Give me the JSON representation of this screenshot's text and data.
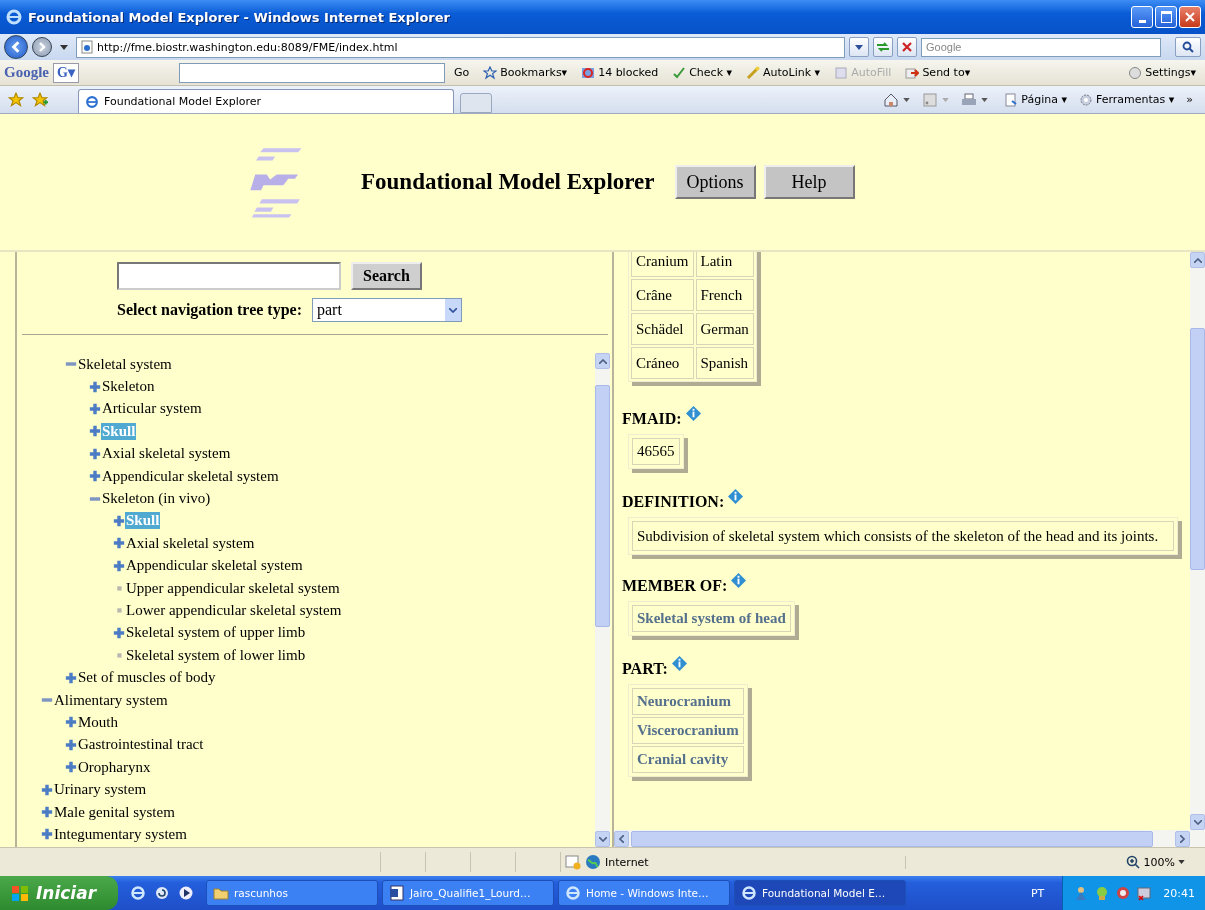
{
  "window": {
    "title": "Foundational Model Explorer - Windows Internet Explorer"
  },
  "address_bar": {
    "url": "http://fme.biostr.washington.edu:8089/FME/index.html",
    "search_placeholder": "Google"
  },
  "google_toolbar": {
    "logo": "Google",
    "menu": "G▾",
    "items": [
      {
        "kind": "go",
        "label": "Go",
        "disabled": false
      },
      {
        "kind": "bookmarks",
        "label": "Bookmarks▾",
        "disabled": false
      },
      {
        "kind": "blocked",
        "label": "14 blocked",
        "disabled": false
      },
      {
        "kind": "check",
        "label": "Check ▾",
        "disabled": false
      },
      {
        "kind": "autolink",
        "label": "AutoLink ▾",
        "disabled": false
      },
      {
        "kind": "autofill",
        "label": "AutoFill",
        "disabled": true
      },
      {
        "kind": "sendto",
        "label": "Send to▾",
        "disabled": false
      }
    ],
    "settings": "Settings▾"
  },
  "tabs": [
    {
      "label": "Foundational Model Explorer",
      "selected": true
    }
  ],
  "command_bar": [
    "Página ▾",
    "Ferramentas ▾",
    "»"
  ],
  "header": {
    "title": "Foundational Model Explorer",
    "buttons": [
      "Options",
      "Help"
    ]
  },
  "search": {
    "button": "Search",
    "tree_type_label": "Select navigation tree type:",
    "tree_type": "part"
  },
  "tree": {
    "continued_children": [
      {
        "label": "Skeletal system",
        "kind": "node",
        "expanded": true,
        "selected": false,
        "children": [
          {
            "label": "Skeleton",
            "kind": "node",
            "expanded": false,
            "selected": false
          },
          {
            "label": "Articular system",
            "kind": "node",
            "expanded": false,
            "selected": false
          },
          {
            "label": "Skull",
            "kind": "node",
            "expanded": false,
            "selected": true
          },
          {
            "label": "Axial skeletal system",
            "kind": "node",
            "expanded": false,
            "selected": false
          },
          {
            "label": "Appendicular skeletal system",
            "kind": "node",
            "expanded": false,
            "selected": false
          },
          {
            "label": "Skeleton (in vivo)",
            "kind": "node",
            "expanded": true,
            "selected": false,
            "children": [
              {
                "label": "Skull",
                "kind": "node",
                "expanded": false,
                "selected": true
              },
              {
                "label": "Axial skeletal system",
                "kind": "node",
                "expanded": false,
                "selected": false
              },
              {
                "label": "Appendicular skeletal system",
                "kind": "node",
                "expanded": false,
                "selected": false
              },
              {
                "label": "Upper appendicular skeletal system",
                "kind": "leaf",
                "selected": false
              },
              {
                "label": "Lower appendicular skeletal system",
                "kind": "leaf",
                "selected": false
              },
              {
                "label": "Skeletal system of upper limb",
                "kind": "node",
                "expanded": false,
                "selected": false
              },
              {
                "label": "Skeletal system of lower limb",
                "kind": "leaf",
                "selected": false
              }
            ]
          }
        ]
      },
      {
        "label": "Set of muscles of body",
        "kind": "node",
        "expanded": false,
        "selected": false
      }
    ],
    "items": [
      {
        "label": "Alimentary system",
        "kind": "node",
        "expanded": true,
        "selected": false,
        "children": [
          {
            "label": "Mouth",
            "kind": "node",
            "expanded": false,
            "selected": false
          },
          {
            "label": "Gastrointestinal tract",
            "kind": "node",
            "expanded": false,
            "selected": false
          },
          {
            "label": "Oropharynx",
            "kind": "node",
            "expanded": false,
            "selected": false
          }
        ]
      },
      {
        "label": "Urinary system",
        "kind": "node",
        "expanded": false,
        "selected": false
      },
      {
        "label": "Male genital system",
        "kind": "node",
        "expanded": false,
        "selected": false
      },
      {
        "label": "Integumentary system",
        "kind": "node",
        "expanded": false,
        "selected": false
      }
    ]
  },
  "details": {
    "synonyms": [
      {
        "term": "Cranium",
        "language": "Latin"
      },
      {
        "term": "Crâne",
        "language": "French"
      },
      {
        "term": "Schädel",
        "language": "German"
      },
      {
        "term": "Cráneo",
        "language": "Spanish"
      }
    ],
    "sections": [
      {
        "kind": "value",
        "label": "FMAID:",
        "items": [
          "46565"
        ]
      },
      {
        "kind": "text",
        "label": "DEFINITION:",
        "items": [
          "Subdivision of skeletal system which consists of the skeleton of the head and its joints."
        ]
      },
      {
        "kind": "links",
        "label": "MEMBER OF:",
        "items": [
          "Skeletal system of head"
        ]
      },
      {
        "kind": "links",
        "label": "PART:",
        "items": [
          "Neurocranium",
          "Viscerocranium",
          "Cranial cavity"
        ]
      }
    ]
  },
  "status_bar": {
    "zone": "Internet",
    "zoom": "100%"
  },
  "taskbar": {
    "start": "Iniciar",
    "tasks": [
      {
        "kind": "folder",
        "label": "rascunhos",
        "selected": false
      },
      {
        "kind": "word",
        "label": "Jairo_Qualifie1_Lourd…",
        "selected": false
      },
      {
        "kind": "ie",
        "label": "Home - Windows Inte…",
        "selected": false
      },
      {
        "kind": "ie",
        "label": "Foundational Model E…",
        "selected": true
      }
    ],
    "language": "PT",
    "clock": "20:41"
  }
}
